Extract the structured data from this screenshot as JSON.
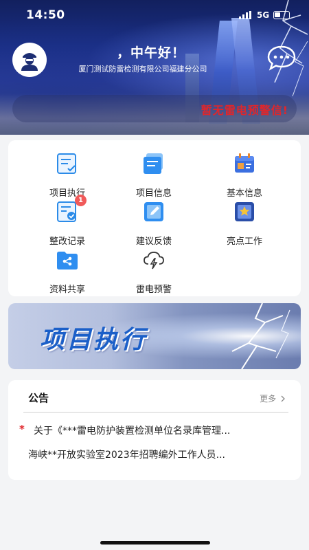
{
  "status_bar": {
    "time": "14:50",
    "network": "5G"
  },
  "header": {
    "greeting": "，中午好！",
    "company": "厦门测试防雷检测有限公司福建分公司",
    "alert": "暂无雷电预警信!"
  },
  "grid": {
    "items": [
      {
        "label": "项目执行",
        "icon": "project-execute-icon"
      },
      {
        "label": "项目信息",
        "icon": "project-info-icon"
      },
      {
        "label": "基本信息",
        "icon": "basic-info-icon"
      },
      {
        "label": "整改记录",
        "icon": "rectify-record-icon",
        "badge": "1"
      },
      {
        "label": "建议反馈",
        "icon": "feedback-icon"
      },
      {
        "label": "亮点工作",
        "icon": "highlight-work-icon"
      },
      {
        "label": "资料共享",
        "icon": "data-share-icon"
      },
      {
        "label": "雷电预警",
        "icon": "lightning-warning-icon"
      }
    ]
  },
  "banner": {
    "title": "项目执行"
  },
  "notice": {
    "title": "公告",
    "more": "更多",
    "items": [
      {
        "text": "关于《***雷电防护装置检测单位名录库管理...",
        "starred": true
      },
      {
        "text": "海峡**开放实验室2023年招聘编外工作人员...",
        "starred": false
      }
    ]
  },
  "colors": {
    "primary": "#2b7fe0",
    "alert": "#e0262b",
    "badge": "#f05a5a"
  }
}
